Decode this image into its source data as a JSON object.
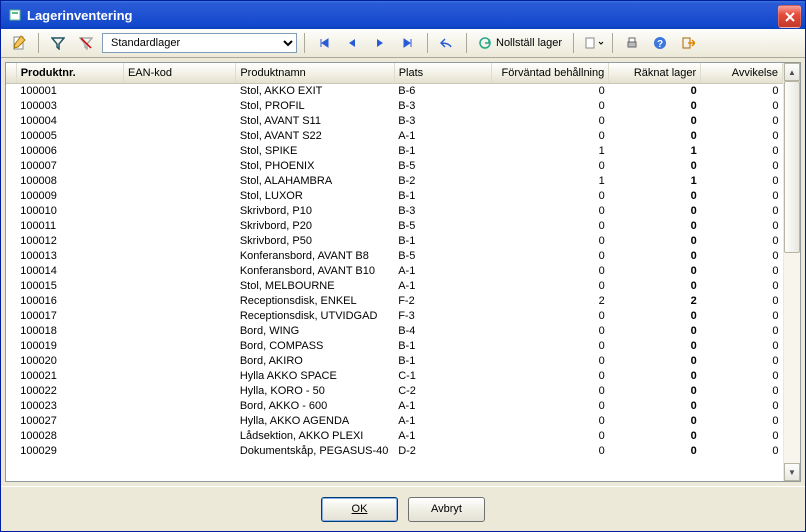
{
  "title": "Lagerinventering",
  "toolbar": {
    "warehouse": "Standardlager",
    "reset_label": "Nollställ lager"
  },
  "columns": {
    "handle": "",
    "product_no": "Produktnr.",
    "ean": "EAN-kod",
    "name": "Produktnamn",
    "location": "Plats",
    "expected": "Förväntad behållning",
    "counted": "Räknat lager",
    "deviation": "Avvikelse"
  },
  "rows": [
    {
      "no": "100001",
      "ean": "",
      "name": "Stol, AKKO EXIT",
      "loc": "B-6",
      "exp": 0,
      "cnt": 0,
      "dev": 0
    },
    {
      "no": "100003",
      "ean": "",
      "name": "Stol, PROFIL",
      "loc": "B-3",
      "exp": 0,
      "cnt": 0,
      "dev": 0
    },
    {
      "no": "100004",
      "ean": "",
      "name": "Stol, AVANT S11",
      "loc": "B-3",
      "exp": 0,
      "cnt": 0,
      "dev": 0
    },
    {
      "no": "100005",
      "ean": "",
      "name": "Stol, AVANT S22",
      "loc": "A-1",
      "exp": 0,
      "cnt": 0,
      "dev": 0
    },
    {
      "no": "100006",
      "ean": "",
      "name": "Stol, SPIKE",
      "loc": "B-1",
      "exp": 1,
      "cnt": 1,
      "dev": 0
    },
    {
      "no": "100007",
      "ean": "",
      "name": "Stol, PHOENIX",
      "loc": "B-5",
      "exp": 0,
      "cnt": 0,
      "dev": 0
    },
    {
      "no": "100008",
      "ean": "",
      "name": "Stol, ALAHAMBRA",
      "loc": "B-2",
      "exp": 1,
      "cnt": 1,
      "dev": 0
    },
    {
      "no": "100009",
      "ean": "",
      "name": "Stol, LUXOR",
      "loc": "B-1",
      "exp": 0,
      "cnt": 0,
      "dev": 0
    },
    {
      "no": "100010",
      "ean": "",
      "name": "Skrivbord, P10",
      "loc": "B-3",
      "exp": 0,
      "cnt": 0,
      "dev": 0
    },
    {
      "no": "100011",
      "ean": "",
      "name": "Skrivbord, P20",
      "loc": "B-5",
      "exp": 0,
      "cnt": 0,
      "dev": 0
    },
    {
      "no": "100012",
      "ean": "",
      "name": "Skrivbord, P50",
      "loc": "B-1",
      "exp": 0,
      "cnt": 0,
      "dev": 0
    },
    {
      "no": "100013",
      "ean": "",
      "name": "Konferansbord, AVANT B8",
      "loc": "B-5",
      "exp": 0,
      "cnt": 0,
      "dev": 0
    },
    {
      "no": "100014",
      "ean": "",
      "name": "Konferansbord, AVANT B10",
      "loc": "A-1",
      "exp": 0,
      "cnt": 0,
      "dev": 0
    },
    {
      "no": "100015",
      "ean": "",
      "name": "Stol, MELBOURNE",
      "loc": "A-1",
      "exp": 0,
      "cnt": 0,
      "dev": 0
    },
    {
      "no": "100016",
      "ean": "",
      "name": "Receptionsdisk, ENKEL",
      "loc": "F-2",
      "exp": 2,
      "cnt": 2,
      "dev": 0
    },
    {
      "no": "100017",
      "ean": "",
      "name": "Receptionsdisk, UTVIDGAD",
      "loc": "F-3",
      "exp": 0,
      "cnt": 0,
      "dev": 0
    },
    {
      "no": "100018",
      "ean": "",
      "name": "Bord, WING",
      "loc": "B-4",
      "exp": 0,
      "cnt": 0,
      "dev": 0
    },
    {
      "no": "100019",
      "ean": "",
      "name": "Bord, COMPASS",
      "loc": "B-1",
      "exp": 0,
      "cnt": 0,
      "dev": 0
    },
    {
      "no": "100020",
      "ean": "",
      "name": "Bord, AKIRO",
      "loc": "B-1",
      "exp": 0,
      "cnt": 0,
      "dev": 0
    },
    {
      "no": "100021",
      "ean": "",
      "name": "Hylla AKKO SPACE",
      "loc": "C-1",
      "exp": 0,
      "cnt": 0,
      "dev": 0
    },
    {
      "no": "100022",
      "ean": "",
      "name": "Hylla, KORO - 50",
      "loc": "C-2",
      "exp": 0,
      "cnt": 0,
      "dev": 0
    },
    {
      "no": "100023",
      "ean": "",
      "name": "Bord, AKKO - 600",
      "loc": "A-1",
      "exp": 0,
      "cnt": 0,
      "dev": 0
    },
    {
      "no": "100027",
      "ean": "",
      "name": "Hylla, AKKO  AGENDA",
      "loc": "A-1",
      "exp": 0,
      "cnt": 0,
      "dev": 0
    },
    {
      "no": "100028",
      "ean": "",
      "name": "Lådsektion, AKKO PLEXI",
      "loc": "A-1",
      "exp": 0,
      "cnt": 0,
      "dev": 0
    },
    {
      "no": "100029",
      "ean": "",
      "name": "Dokumentskåp, PEGASUS-40",
      "loc": "D-2",
      "exp": 0,
      "cnt": 0,
      "dev": 0
    }
  ],
  "buttons": {
    "ok": "OK",
    "cancel": "Avbryt"
  }
}
